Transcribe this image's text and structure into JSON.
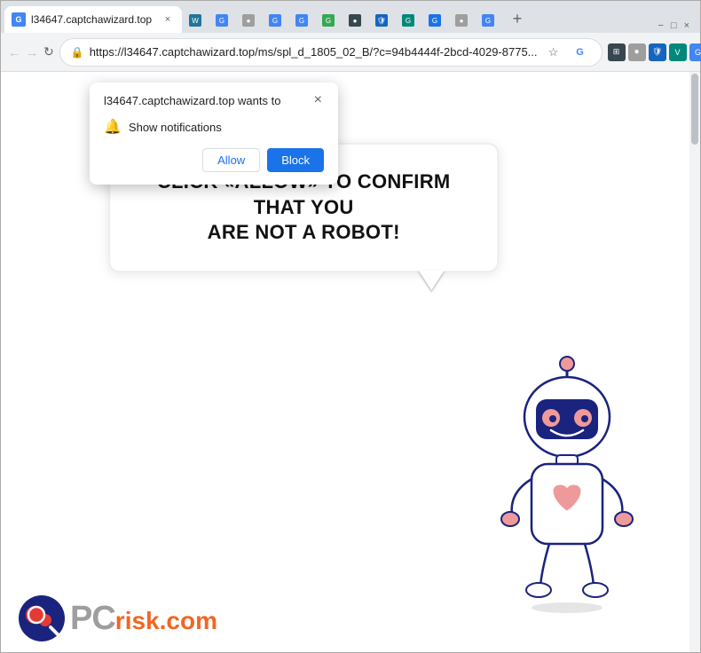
{
  "browser": {
    "tab": {
      "title": "l34647.captchawizard.top",
      "close_label": "×",
      "new_tab_label": "+"
    },
    "window_controls": {
      "minimize": "−",
      "maximize": "□",
      "close": "×"
    },
    "nav": {
      "back_label": "←",
      "forward_label": "→",
      "reload_label": "↻"
    },
    "address": {
      "url": "https://l34647.captchawizard.top/ms/spl_d_1805_02_B/?c=94b4444f-2bcd-4029-8775...",
      "lock_icon": "🔒"
    }
  },
  "notification_popup": {
    "title": "l34647.captchawizard.top wants to",
    "close_label": "×",
    "permission_label": "Show notifications",
    "allow_label": "Allow",
    "block_label": "Block"
  },
  "page": {
    "bubble_text_line1": "CLICK «ALLOW» TO CONFIRM THAT YOU",
    "bubble_text_line2": "ARE NOT A ROBOT!"
  },
  "branding": {
    "name": "PCrisk.com",
    "pc_text": "PC",
    "risk_text": "risk.com"
  },
  "colors": {
    "allow_btn": "#1a73e8",
    "block_btn": "#1a73e8",
    "brand_orange": "#f26522",
    "brand_gray": "#aaa"
  }
}
